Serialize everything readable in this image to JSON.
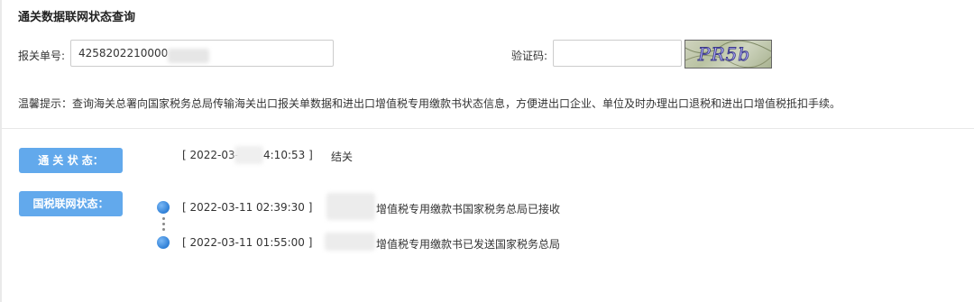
{
  "page": {
    "title": "通关数据联网状态查询",
    "tip": "温馨提示：查询海关总署向国家税务总局传输海关出口报关单数据和进出口增值税专用缴款书状态信息，方便进出口企业、单位及时办理出口退税和进出口增值税抵扣手续。"
  },
  "form": {
    "declaration_label": "报关单号:",
    "declaration_value": "4258202210000",
    "captcha_label": "验证码:",
    "captcha_value": "",
    "captcha_text": "PR5b"
  },
  "customs_status": {
    "label": "通 关 状 态：",
    "time": "[ 2022-03-",
    "time_suffix": "4:10:53 ]",
    "status": "结关"
  },
  "tax_status": {
    "label": "国税联网状态：",
    "entries": [
      {
        "time": "[ 2022-03-11 02:39:30 ]",
        "text": "增值税专用缴款书国家税务总局已接收"
      },
      {
        "time": "[ 2022-03-11 01:55:00 ]",
        "text": "增值税专用缴款书已发送国家税务总局"
      }
    ]
  }
}
